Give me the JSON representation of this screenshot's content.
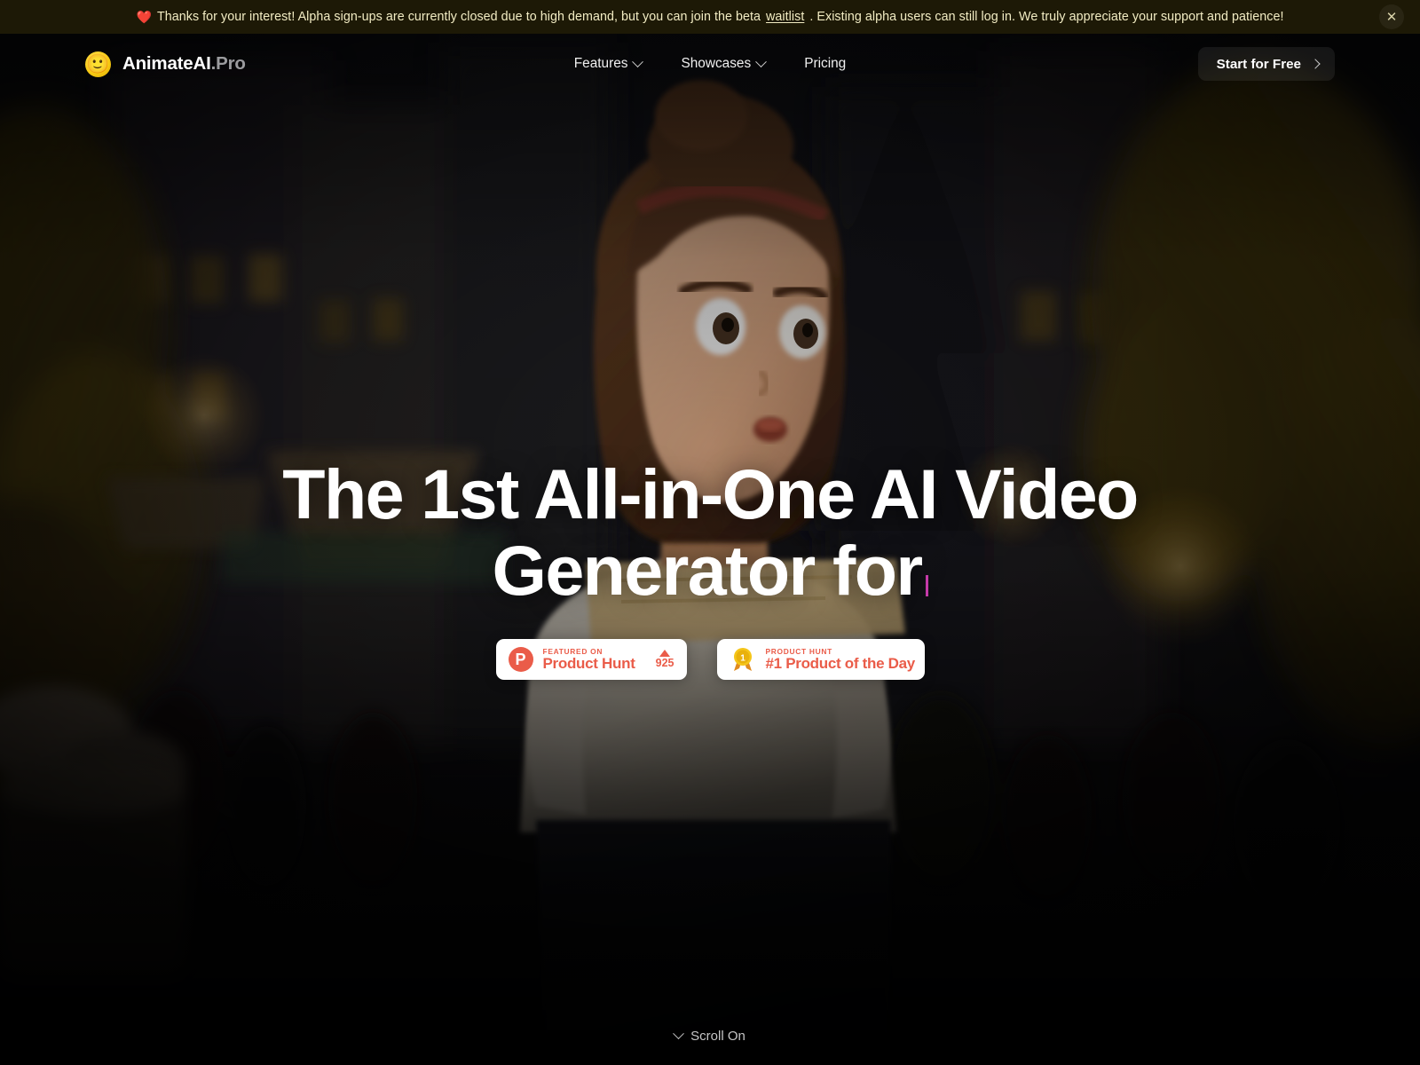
{
  "banner": {
    "heart_icon": "heart-icon",
    "text_before": "Thanks for your interest! Alpha sign-ups are currently closed due to high demand, but you can join the beta ",
    "link_label": "waitlist",
    "text_after": ". Existing alpha users can still log in. We truly appreciate your support and patience!",
    "close_label": "✕",
    "background": "#1d1906",
    "text_color": "#f2ecc3"
  },
  "header": {
    "logo": {
      "emoji": "🙂",
      "name": "AnimateAI",
      "suffix": ".Pro"
    },
    "nav": [
      {
        "label": "Features",
        "has_dropdown": true
      },
      {
        "label": "Showcases",
        "has_dropdown": true
      },
      {
        "label": "Pricing",
        "has_dropdown": false
      }
    ],
    "cta": {
      "label": "Start for Free",
      "icon": "chevron-right-icon"
    }
  },
  "hero": {
    "headline_line1": "The 1st All-in-One AI Video Generator",
    "headline_line2": "for",
    "caret_color": "#c43aa8",
    "badges": [
      {
        "id": "product-hunt-featured",
        "icon": "product-hunt-logo-icon",
        "kicker": "FEATURED ON",
        "title": "Product Hunt",
        "vote_icon": "triangle-up-icon",
        "vote_count": "925",
        "accent": "#ea5c49"
      },
      {
        "id": "product-of-the-day",
        "icon": "gold-medal-icon",
        "kicker": "PRODUCT HUNT",
        "title": "#1 Product of the Day",
        "accent": "#ea5c49"
      }
    ]
  },
  "scroll_cue": {
    "icon": "chevron-down-icon",
    "label": "Scroll On"
  }
}
